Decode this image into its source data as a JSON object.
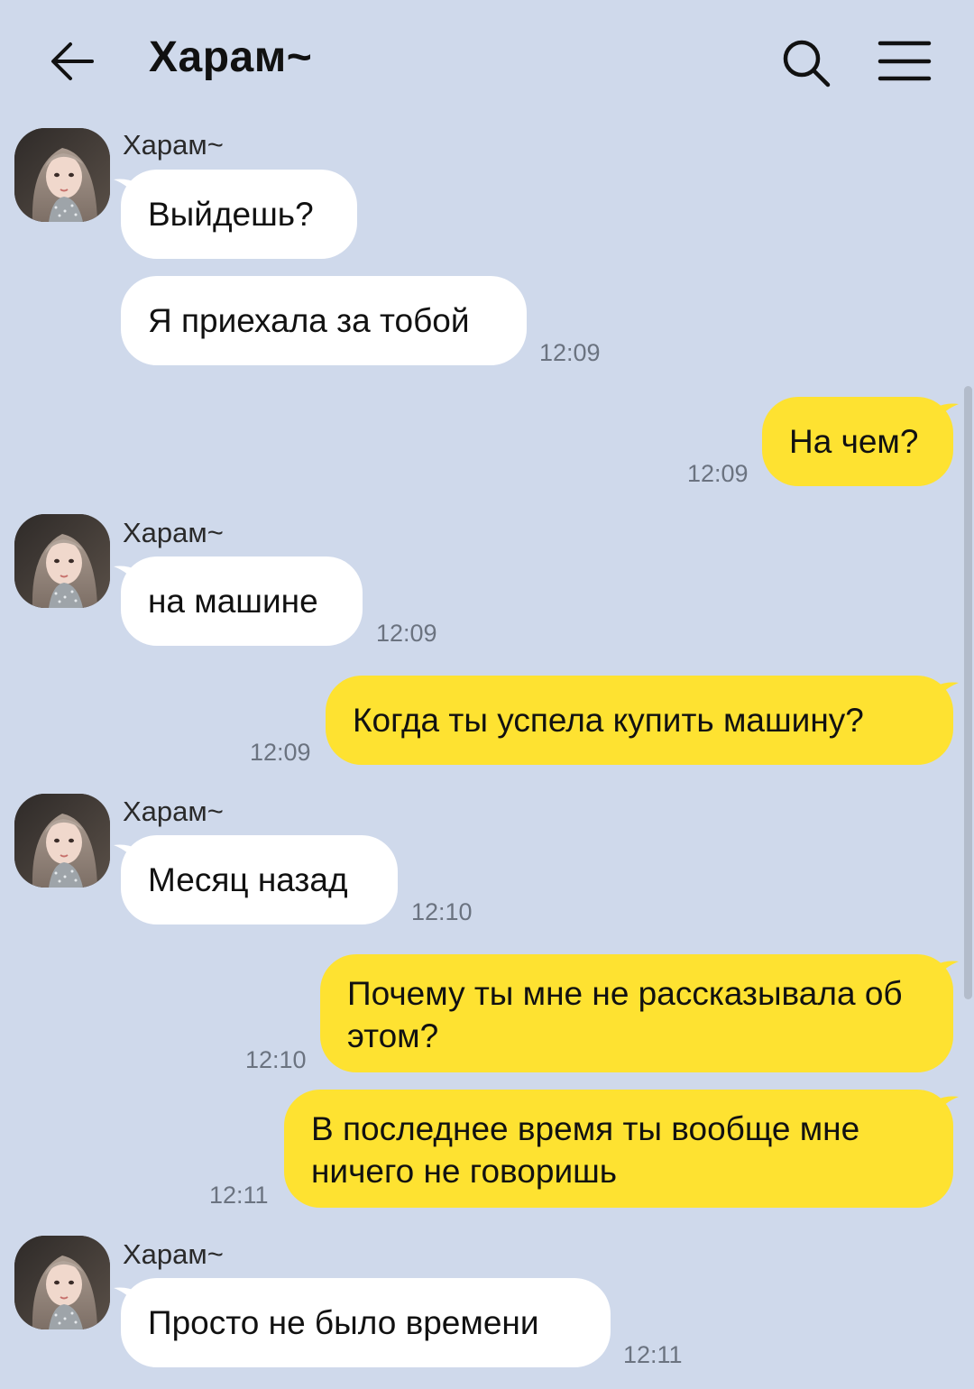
{
  "header": {
    "title": "Харам~"
  },
  "colors": {
    "background": "#cfd9eb",
    "incoming_bubble": "#ffffff",
    "outgoing_bubble": "#fee231"
  },
  "messages": [
    {
      "direction": "in",
      "sender": "Харам~",
      "text": "Выйдешь?",
      "time": ""
    },
    {
      "direction": "in",
      "sender": "",
      "text": "Я приехала за тобой",
      "time": "12:09"
    },
    {
      "direction": "out",
      "text": "На чем?",
      "time": "12:09"
    },
    {
      "direction": "in",
      "sender": "Харам~",
      "text": "на машине",
      "time": "12:09"
    },
    {
      "direction": "out",
      "text": "Когда ты успела купить машину?",
      "time": "12:09"
    },
    {
      "direction": "in",
      "sender": "Харам~",
      "text": "Месяц назад",
      "time": "12:10"
    },
    {
      "direction": "out",
      "text": "Почему ты мне не рассказывала об этом?",
      "time": "12:10"
    },
    {
      "direction": "out",
      "text": "В последнее время ты вообще мне ничего не говоришь",
      "time": "12:11"
    },
    {
      "direction": "in",
      "sender": "Харам~",
      "text": "Просто не было времени",
      "time": "12:11"
    }
  ]
}
